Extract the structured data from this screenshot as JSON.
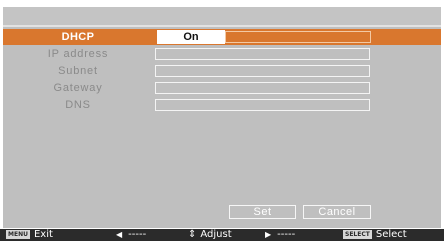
{
  "menu": {
    "rows": [
      {
        "label": "DHCP",
        "value": "On"
      },
      {
        "label": "IP address",
        "value": ""
      },
      {
        "label": "Subnet",
        "value": ""
      },
      {
        "label": "Gateway",
        "value": ""
      },
      {
        "label": "DNS",
        "value": ""
      }
    ]
  },
  "buttons": {
    "set": "Set",
    "cancel": "Cancel"
  },
  "footer": {
    "exit_key": "MENU",
    "exit_label": "Exit",
    "left_icon": "triangle-left-icon",
    "left_label": "-----",
    "adjust_icon": "up-down-icon",
    "adjust_label": "Adjust",
    "right_icon": "triangle-right-icon",
    "right_label": "-----",
    "select_key": "SELECT",
    "select_label": "Select"
  },
  "colors": {
    "accent": "#d9772e",
    "panel": "#bfbfbf",
    "footer": "#2b2b2b"
  }
}
